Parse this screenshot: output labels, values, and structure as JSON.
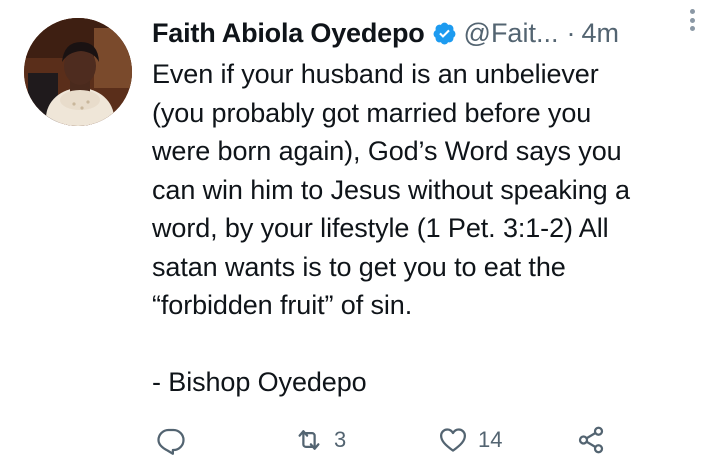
{
  "tweet": {
    "author_name": "Faith Abiola Oyedepo",
    "handle": "@Fait...",
    "separator": "·",
    "time": "4m",
    "verified": true,
    "lines": [
      "Even if your husband is an unbeliever",
      "(you probably got married before you",
      "were born again), God’s Word says you",
      "can win him to Jesus without speaking a",
      "word, by your lifestyle (1 Pet. 3:1-2) All",
      "satan wants is to get you to eat the",
      "“forbidden fruit” of sin."
    ],
    "signature": "- Bishop Oyedepo"
  },
  "actions": {
    "reply_icon": "reply-icon",
    "retweet_icon": "retweet-icon",
    "retweet_count": "3",
    "like_icon": "heart-icon",
    "like_count": "14",
    "share_icon": "share-icon"
  },
  "colors": {
    "text": "#0f1419",
    "secondary": "#536471",
    "verified": "#1d9bf0"
  }
}
